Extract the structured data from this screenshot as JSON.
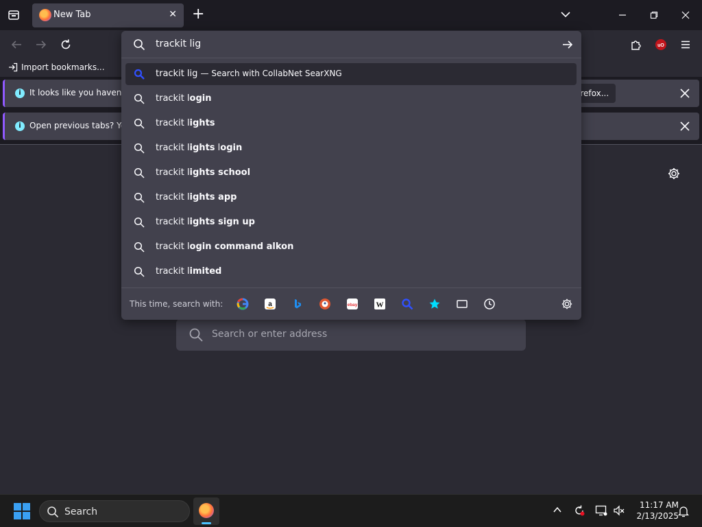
{
  "tab": {
    "title": "New Tab",
    "close": "✕"
  },
  "newtab": "+",
  "bookmarks": {
    "import_label": "Import bookmarks..."
  },
  "notices": [
    {
      "text": "It looks like you haven't st",
      "button": "Firefox..."
    },
    {
      "text": "Open previous tabs? You c"
    }
  ],
  "urlbar": {
    "input_value": "trackit lig",
    "results": [
      {
        "prefix": "trackit lig",
        "suffix": "",
        "action": "— Search with CollabNet SearXNG"
      },
      {
        "prefix": "trackit l",
        "suffix": "ogin"
      },
      {
        "prefix": "trackit l",
        "suffix": "ights"
      },
      {
        "prefix": "trackit l",
        "suffix": "ights login",
        "mixed": [
          "ights",
          " l",
          "ogin"
        ]
      },
      {
        "prefix": "trackit l",
        "suffix": "ights school"
      },
      {
        "prefix": "trackit l",
        "suffix": "ights app"
      },
      {
        "prefix": "trackit l",
        "suffix": "ights sign up"
      },
      {
        "prefix": "trackit l",
        "suffix": "ogin command alkon"
      },
      {
        "prefix": "trackit l",
        "suffix": "imited"
      }
    ],
    "oneoff_label": "This time, search with:",
    "engines": [
      "google",
      "amazon",
      "bing",
      "duckduckgo",
      "ebay",
      "wikipedia",
      "searxng",
      "bookmarks",
      "tabs",
      "history"
    ]
  },
  "home_search_placeholder": "Search or enter address",
  "taskbar": {
    "search_label": "Search",
    "time": "11:17 AM",
    "date": "2/13/2025"
  },
  "colors": {
    "accent": "#9059ff",
    "info": "#80ebff",
    "windows_blue": "#3aa0f3"
  }
}
